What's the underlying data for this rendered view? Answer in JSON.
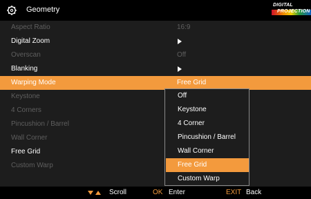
{
  "header": {
    "title": "Geometry",
    "logo_line1": "DIGITAL",
    "logo_line2": "PROJECTION",
    "icon": "gear-icon"
  },
  "menu": {
    "rows": [
      {
        "label": "Aspect Ratio",
        "value": "16:9",
        "state": "disabled"
      },
      {
        "label": "Digital Zoom",
        "value": "",
        "submenu": true,
        "state": "enabled"
      },
      {
        "label": "Overscan",
        "value": "Off",
        "state": "disabled"
      },
      {
        "label": "Blanking",
        "value": "",
        "submenu": true,
        "state": "enabled"
      },
      {
        "label": "Warping Mode",
        "value": "Free Grid",
        "state": "selected"
      },
      {
        "label": "Keystone",
        "state": "disabled"
      },
      {
        "label": "4 Corners",
        "state": "disabled"
      },
      {
        "label": "Pincushion / Barrel",
        "state": "disabled"
      },
      {
        "label": "Wall Corner",
        "state": "disabled"
      },
      {
        "label": "Free Grid",
        "state": "enabled"
      },
      {
        "label": "Custom Warp",
        "state": "disabled"
      }
    ]
  },
  "dropdown": {
    "options": [
      "Off",
      "Keystone",
      "4 Corner",
      "Pincushion / Barrel",
      "Wall Corner",
      "Free Grid",
      "Custom Warp"
    ],
    "selected": "Free Grid"
  },
  "footer": {
    "scroll_label": "Scroll",
    "ok_key": "OK",
    "enter_label": "Enter",
    "exit_key": "EXIT",
    "back_label": "Back"
  },
  "colors": {
    "accent": "#f39a3d",
    "background": "#1d1d1d",
    "bar": "#000000",
    "disabled_text": "#5f5f5f"
  }
}
